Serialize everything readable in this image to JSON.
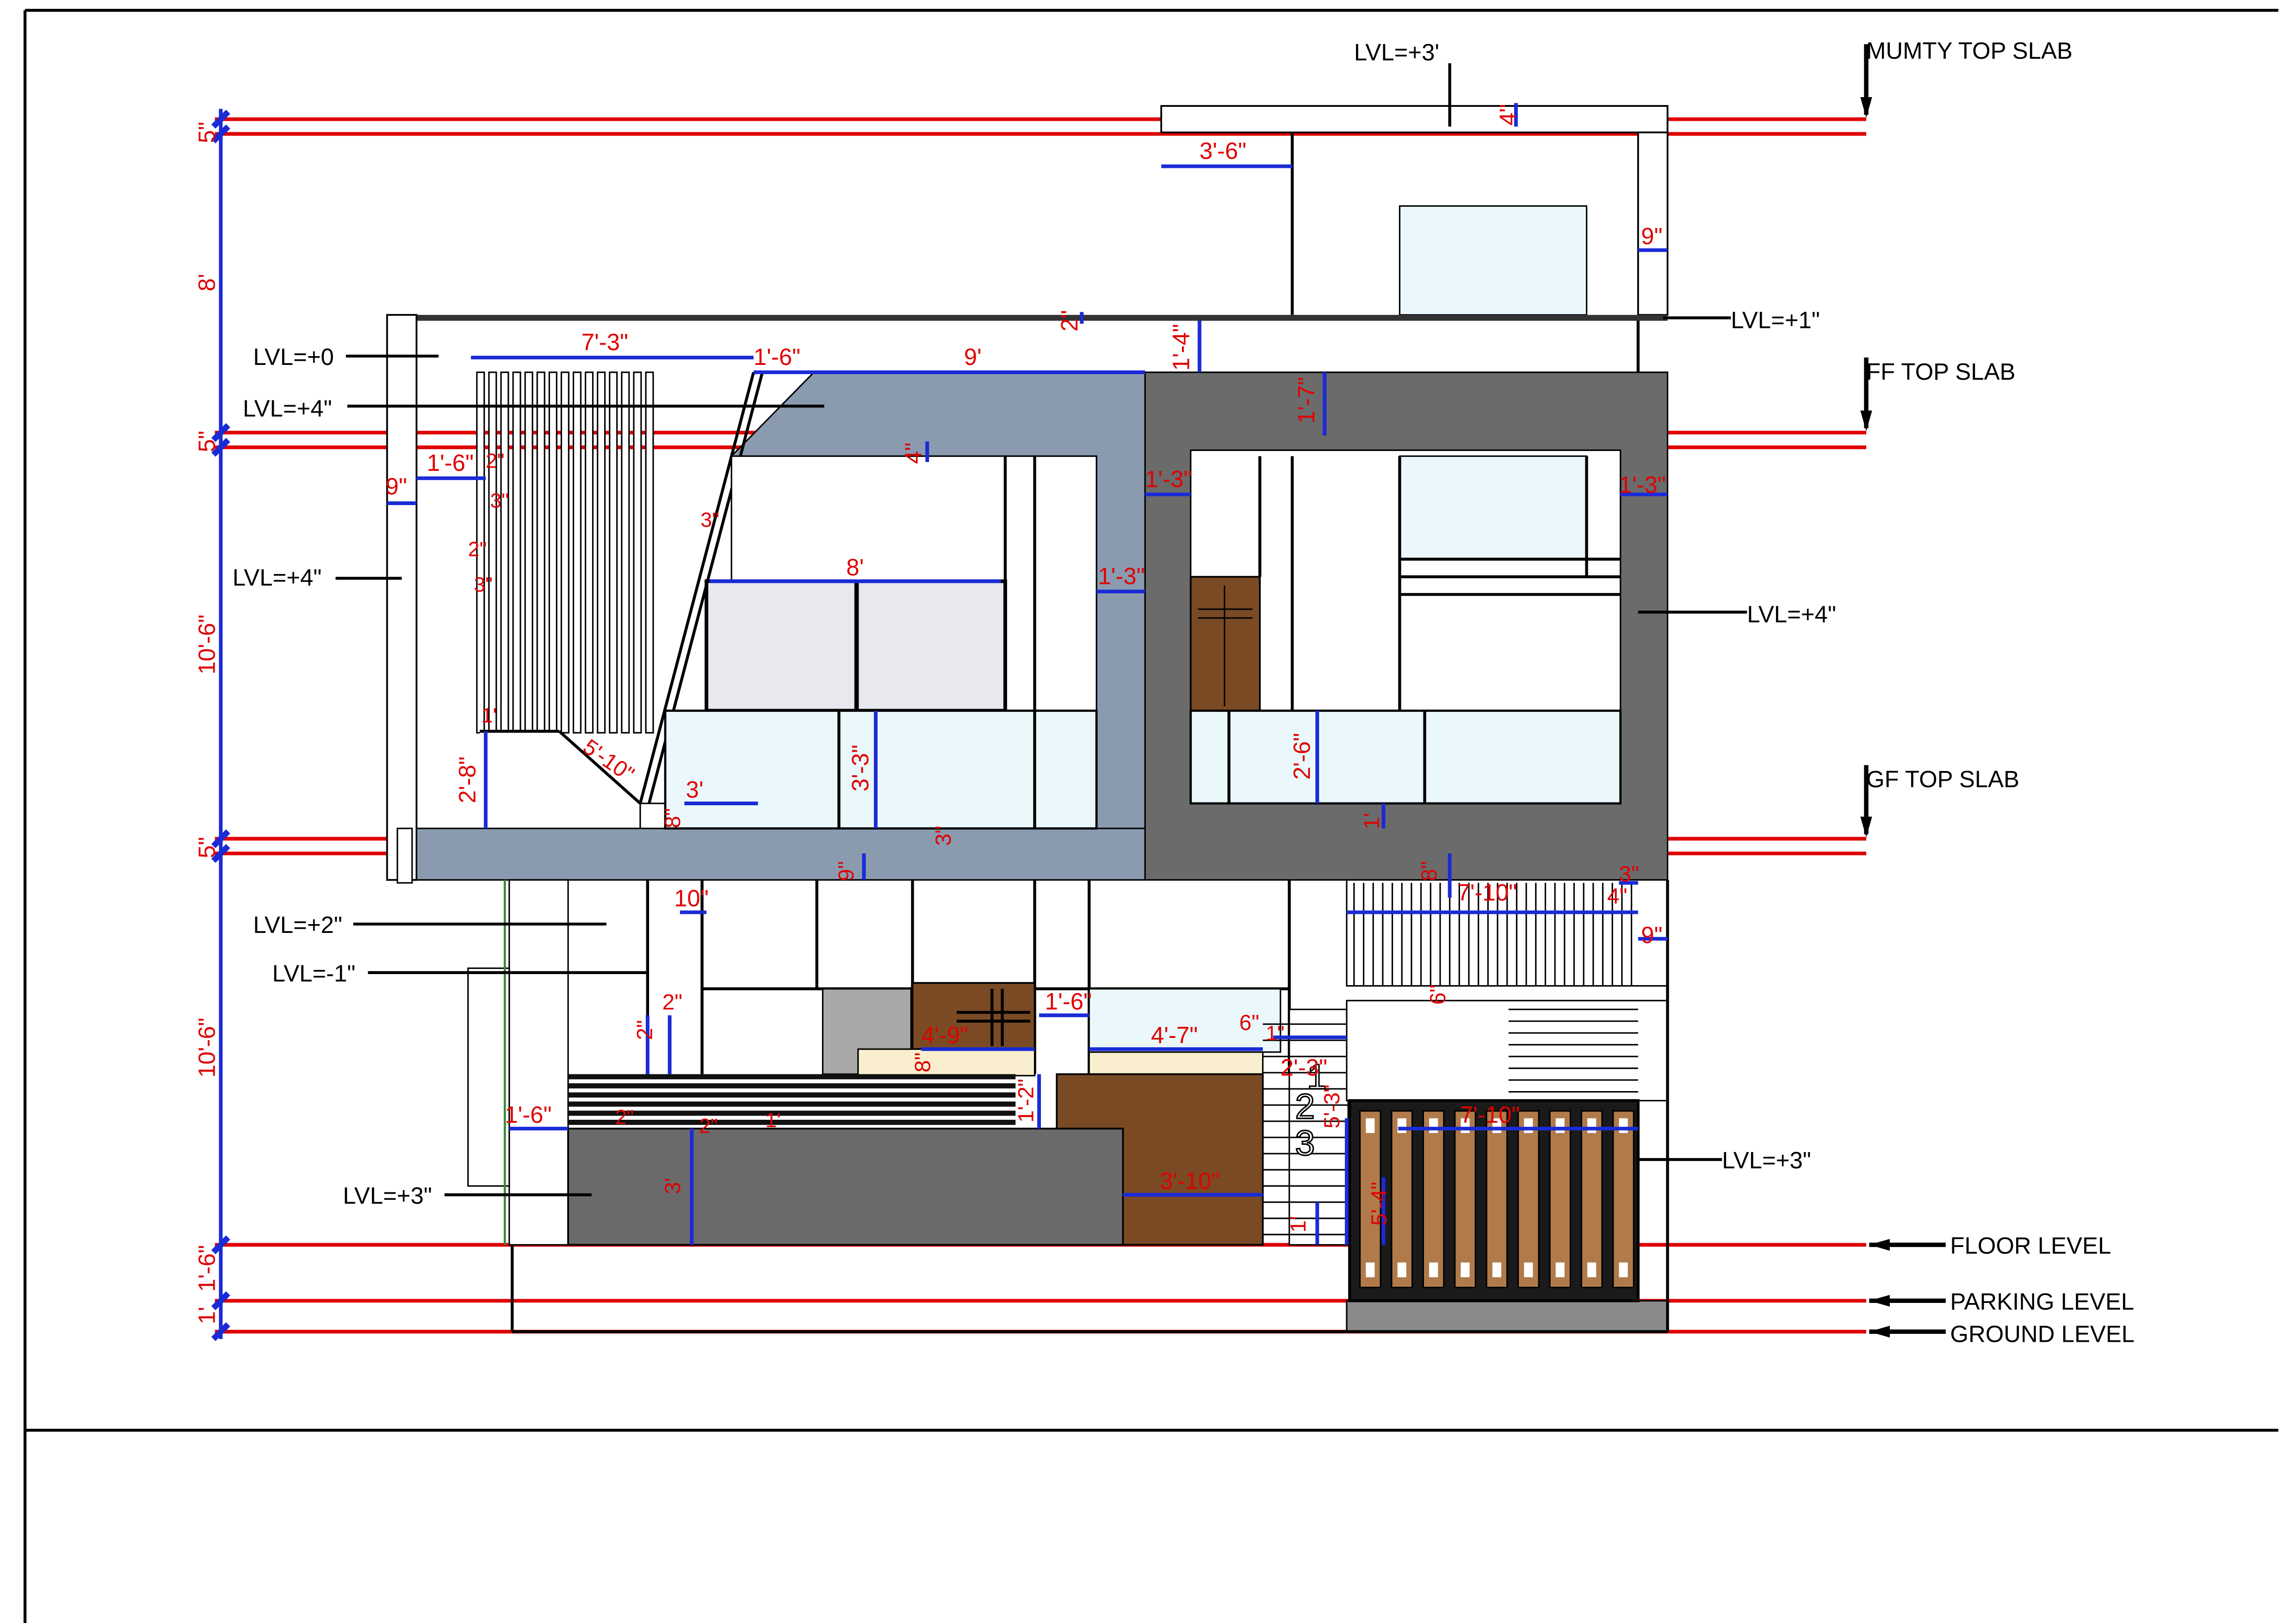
{
  "levels": {
    "mumty_top_slab": "MUMTY TOP SLAB",
    "ff_top_slab": "FF TOP SLAB",
    "gf_top_slab": "GF TOP SLAB",
    "floor_level": "FLOOR LEVEL",
    "parking_level": "PARKING LEVEL",
    "ground_level": "GROUND LEVEL"
  },
  "lvl_notes": {
    "mumty": "LVL=+3'",
    "parapet_right": "LVL=+1\"",
    "parapet_left": "LVL=+0",
    "ff_band": "LVL=+4\"",
    "ff_left_wall": "LVL=+4\"",
    "ff_right_frame": "LVL=+4\"",
    "gf_wall": "LVL=+2\"",
    "gf_recess": "LVL=-1\"",
    "gf_planter": "LVL=+3\"",
    "gf_gate": "LVL=+3\""
  },
  "height_dims": {
    "mumty_slab": "5\"",
    "mumty_height": "8'",
    "ff_slab": "5\"",
    "ff_height": "10'-6\"",
    "gf_slab": "5\"",
    "gf_height": "10'-6\"",
    "plinth": "1'-6\"",
    "parking_to_ground": "1'"
  },
  "dims": {
    "mumty_edge": "4\"",
    "mumty_canopy": "3'-6\"",
    "mumty_wall": "9\"",
    "parapet_thk": "2\"",
    "louver_width": "7'-3\"",
    "louver_gap": "1'-6\"",
    "band_width": "9'",
    "band_drop": "1'-4\"",
    "band_height": "1'-7\"",
    "ff_slab_mark": "4\"",
    "ff_wall_left": "9\"",
    "ff_ledge": "1'-6\"",
    "fin_a": "2\"",
    "fin_b": "3\"",
    "fin_c": "2\"",
    "fin_d": "3\"",
    "fin_e": "3\"",
    "frame_left_a": "1'-3\"",
    "frame_right_a": "1'-3\"",
    "frame_side": "1'-3\"",
    "window_width": "8'",
    "diag": "5'-10\"",
    "fin_base": "1'",
    "sill_height": "2'-8\"",
    "sill_ledge": "3'",
    "sill_mark": "8\"",
    "glass_rail": "3'-3\"",
    "slab_mark": "3\"",
    "rail_right": "2'-6\"",
    "rail_right_base": "1'",
    "beam_drop": "9\"",
    "gf_col": "10\"",
    "gf_right_drop": "8\"",
    "gf_right_width": "7'-10\"",
    "gf_right_a": "4\"",
    "gf_right_b": "3\"",
    "gf_right_wall": "9\"",
    "gf_step_mark": "6\"",
    "gf_recess_a": "2\"",
    "gf_recess_b": "2\"",
    "door_width": "4'-9\"",
    "door_sill": "8\"",
    "gap_mid": "1'-6\"",
    "win_mid": "4'-7\"",
    "step_top": "6\"",
    "step_1": "1\"",
    "step_h": "2'-3\"",
    "stair_h": "5'-3\"",
    "planter_left": "1'-6\"",
    "rail_a": "2\"",
    "rail_b": "2\"",
    "rail_c": "1'",
    "planter_block": "1'-2\"",
    "planter_height": "3'",
    "planter_width": "3'-10\"",
    "plinth_mark": "1'",
    "gate_height": "5'-4\"",
    "gate_width": "7'-10\""
  },
  "steps": [
    "1",
    "2",
    "3"
  ],
  "colors": {
    "dim_red": "#e00000",
    "dim_blue": "#1a2bd6",
    "cladding_blue": "#8a9bb0",
    "frame_dark": "#6b6b6b",
    "wood": "#7a4a24",
    "glass": "#eaf8fb",
    "planter": "#6a6a6a"
  }
}
